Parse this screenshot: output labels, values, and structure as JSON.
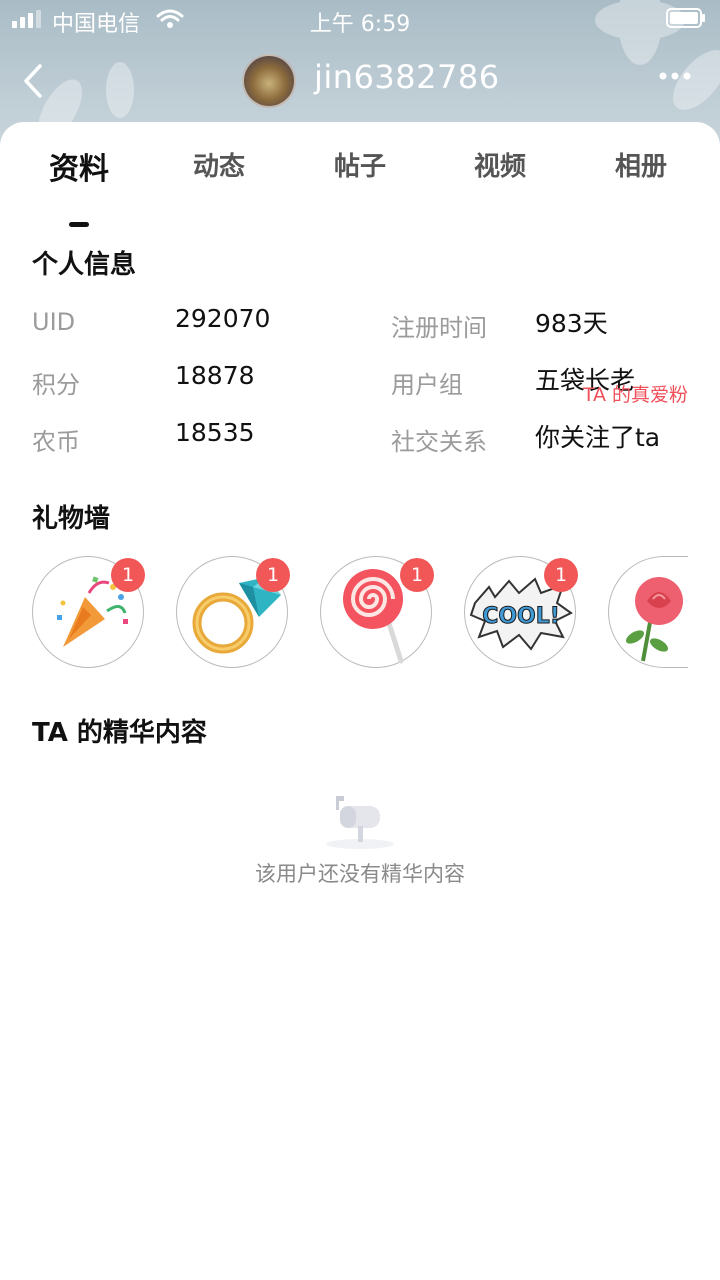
{
  "status_bar": {
    "carrier": "中国电信",
    "time": "上午 6:59"
  },
  "profile": {
    "username": "jin6382786"
  },
  "tabs": [
    {
      "label": "资料",
      "active": true
    },
    {
      "label": "动态",
      "active": false
    },
    {
      "label": "帖子",
      "active": false
    },
    {
      "label": "视频",
      "active": false
    },
    {
      "label": "相册",
      "active": false
    }
  ],
  "personal_info": {
    "title": "个人信息",
    "fields": [
      {
        "label": "UID",
        "value": "292070"
      },
      {
        "label": "注册时间",
        "value": "983天"
      },
      {
        "label": "积分",
        "value": "18878"
      },
      {
        "label": "用户组",
        "value": "五袋长老"
      },
      {
        "label": "农币",
        "value": "18535"
      },
      {
        "label": "社交关系",
        "value": "你关注了ta"
      }
    ]
  },
  "gift_wall": {
    "title": "礼物墙",
    "fans_link": "TA 的真爱粉",
    "gifts": [
      {
        "icon": "party-popper-icon",
        "count": "1"
      },
      {
        "icon": "diamond-ring-icon",
        "count": "1"
      },
      {
        "icon": "lollipop-icon",
        "count": "1"
      },
      {
        "icon": "cool-sticker-icon",
        "count": "1"
      },
      {
        "icon": "rose-icon",
        "count": ""
      }
    ]
  },
  "featured": {
    "title": "TA 的精华内容",
    "empty_text": "该用户还没有精华内容"
  },
  "colors": {
    "accent_red": "#f25757",
    "link_red": "#f0505a"
  }
}
